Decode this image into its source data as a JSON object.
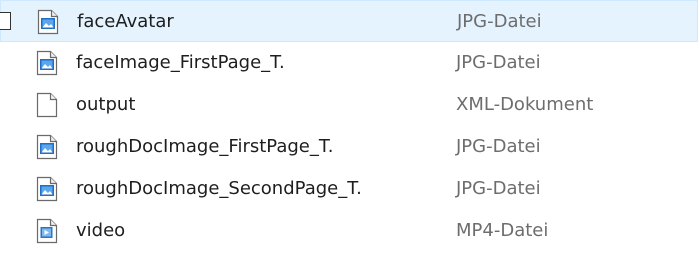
{
  "files": [
    {
      "name": "faceAvatar",
      "type": "JPG-Datei",
      "icon": "image-file-icon",
      "selected": true
    },
    {
      "name": "faceImage_FirstPage_T.",
      "type": "JPG-Datei",
      "icon": "image-file-icon",
      "selected": false
    },
    {
      "name": "output",
      "type": "XML-Dokument",
      "icon": "document-file-icon",
      "selected": false
    },
    {
      "name": "roughDocImage_FirstPage_T.",
      "type": "JPG-Datei",
      "icon": "image-file-icon",
      "selected": false
    },
    {
      "name": "roughDocImage_SecondPage_T.",
      "type": "JPG-Datei",
      "icon": "image-file-icon",
      "selected": false
    },
    {
      "name": "video",
      "type": "MP4-Datei",
      "icon": "video-file-icon",
      "selected": false
    }
  ],
  "colors": {
    "selection_background": "#e5f3ff",
    "selection_border": "#cde8ff",
    "image_icon_accent": "#1f6fc5",
    "name_text": "#1e1e1e",
    "type_text": "#6d6d6d"
  }
}
